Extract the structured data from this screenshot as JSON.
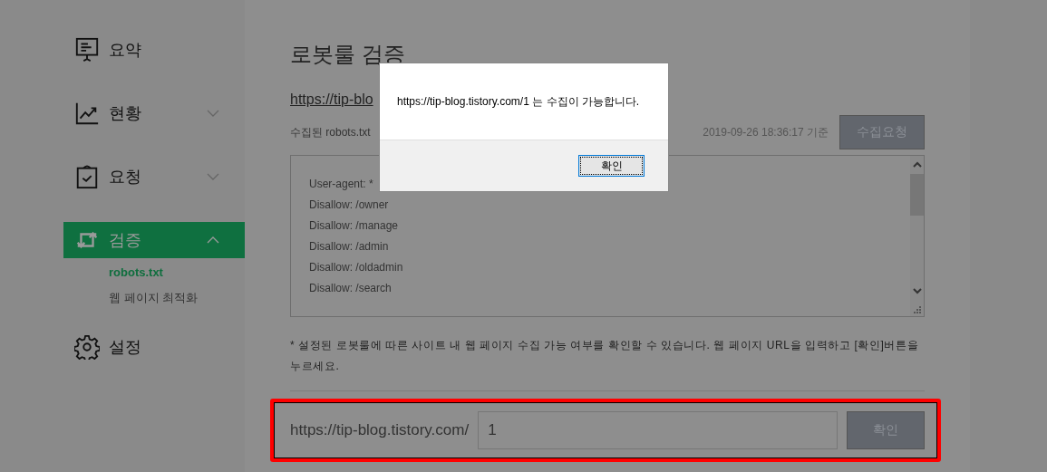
{
  "sidebar": {
    "items": [
      {
        "label": "요약",
        "kind": "link",
        "selected": false
      },
      {
        "label": "현황",
        "kind": "group",
        "selected": false,
        "expanded": false
      },
      {
        "label": "요청",
        "kind": "group",
        "selected": false,
        "expanded": false
      },
      {
        "label": "검증",
        "kind": "group",
        "selected": true,
        "expanded": true,
        "children": [
          {
            "label": "robots.txt",
            "selected": true
          },
          {
            "label": "웹 페이지 최적화",
            "selected": false
          }
        ]
      },
      {
        "label": "설정",
        "kind": "link",
        "selected": false
      }
    ]
  },
  "main": {
    "title": "로봇룰 검증",
    "site_link": "https://tip-blo",
    "collected_label": "수집된 robots.txt",
    "timestamp": "2019-09-26 18:36:17 기준",
    "request_button": "수집요청",
    "robots_lines": [
      "User-agent: *",
      "Disallow: /owner",
      "Disallow: /manage",
      "Disallow: /admin",
      "Disallow: /oldadmin",
      "Disallow: /search"
    ],
    "note": "* 설정된 로봇룰에 따른 사이트 내 웹 페이지 수집 가능 여부를 확인할 수 있습니다. 웹 페이지 URL을 입력하고 [확인]버튼을 누르세요.",
    "url_check": {
      "prefix": "https://tip-blog.tistory.com/",
      "value": "1",
      "button": "확인"
    }
  },
  "dialog": {
    "message": "https://tip-blog.tistory.com/1 는 수집이 가능합니다.",
    "ok_button": "확인"
  }
}
